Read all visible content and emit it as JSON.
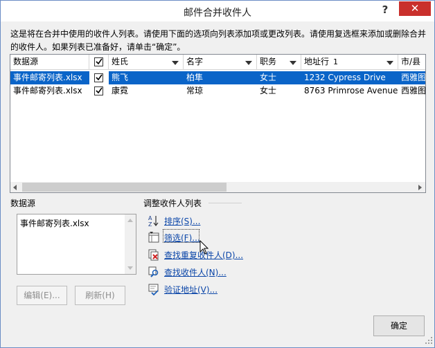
{
  "dialog": {
    "title": "邮件合并收件人",
    "help_label": "?",
    "close_label": "✕",
    "description_line1": "这是将在合并中使用的收件人列表。请使用下面的选项向列表添加项或更改列表。请使用复选框来添加或删除合并",
    "description_line2": "的收件人。如果列表已准备好，请单击“确定”。"
  },
  "grid": {
    "headers": [
      "数据源",
      "",
      "姓氏",
      "名字",
      "职务",
      "地址行",
      "市/县"
    ],
    "address_header_suffix": "1",
    "rows": [
      {
        "source": "事件邮寄列表.xlsx",
        "checked": true,
        "last": "熊飞",
        "first": "柏隼",
        "title": "女士",
        "address": "1232 Cypress Drive",
        "city": "西雅图"
      },
      {
        "source": "事件邮寄列表.xlsx",
        "checked": true,
        "last": "康霓",
        "first": "常琼",
        "title": "女士",
        "address": "8763 Primrose Avenue",
        "city": "西雅图"
      }
    ]
  },
  "datasource": {
    "label": "数据源",
    "items": [
      "事件邮寄列表.xlsx"
    ],
    "edit_label": "编辑(E)...",
    "refresh_label": "刷新(H)"
  },
  "refine": {
    "label": "调整收件人列表",
    "links": [
      {
        "label": "排序(S)...",
        "icon": "sort-az-icon"
      },
      {
        "label": "筛选(F)...",
        "icon": "filter-icon"
      },
      {
        "label": "查找重复收件人(D)...",
        "icon": "duplicate-remove-icon"
      },
      {
        "label": "查找收件人(N)...",
        "icon": "find-search-icon"
      },
      {
        "label": "验证地址(V)...",
        "icon": "validate-address-icon"
      }
    ]
  },
  "ok_label": "确定",
  "colors": {
    "selection": "#0a64c8",
    "link": "#0a45a8",
    "close": "#c9302c"
  }
}
